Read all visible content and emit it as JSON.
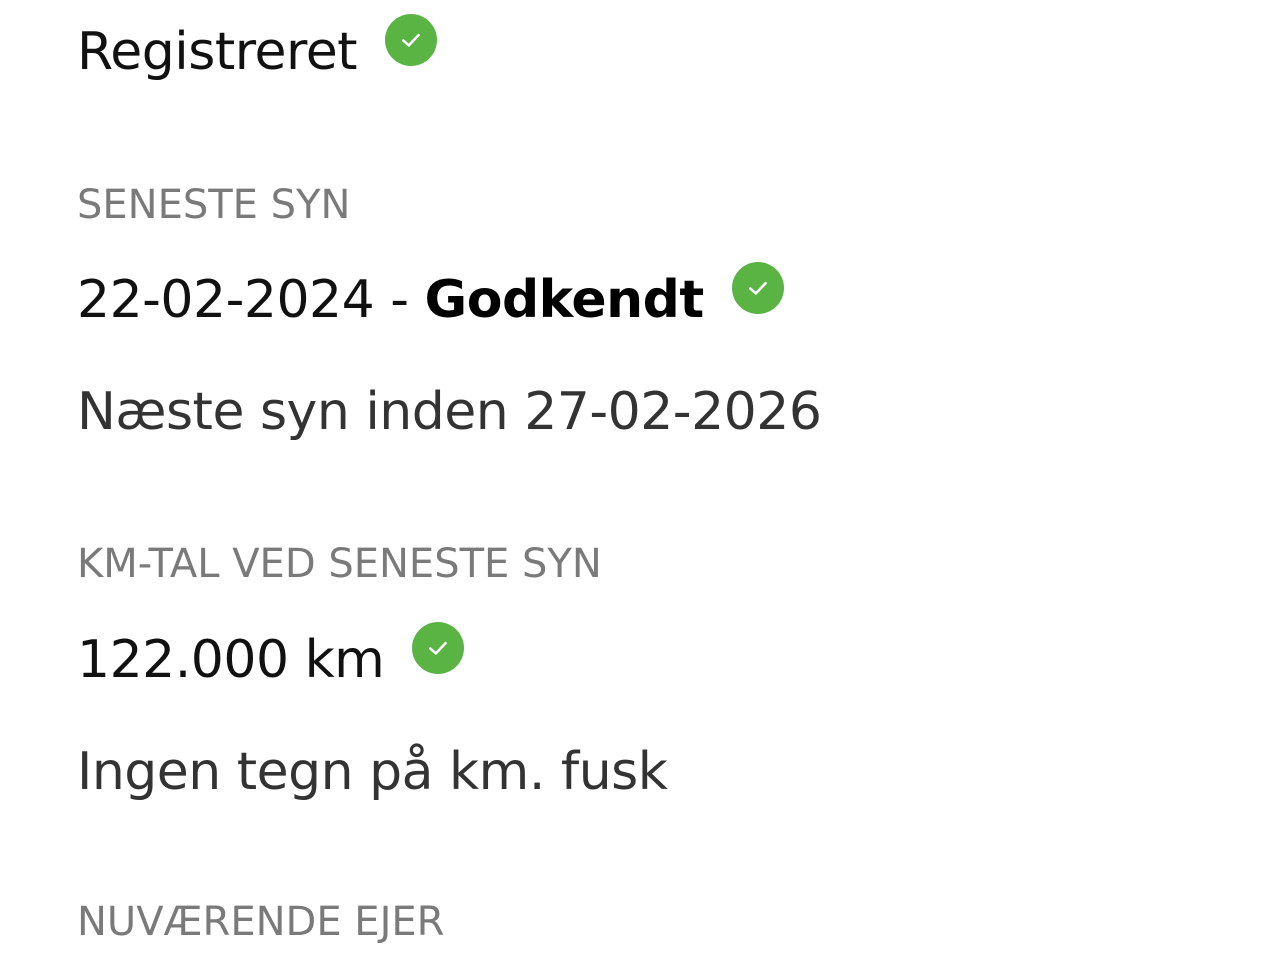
{
  "registration": {
    "status_text": "Registreret",
    "status_icon": "check-circle-icon"
  },
  "inspection": {
    "label": "SENESTE SYN",
    "date": "22-02-2024",
    "separator": " - ",
    "result": "Godkendt",
    "result_icon": "check-circle-icon",
    "next_inspection_text": "Næste syn inden 27-02-2026"
  },
  "mileage": {
    "label": "KM-TAL VED SENESTE SYN",
    "value": "122.000 km",
    "value_icon": "check-circle-icon",
    "fraud_text": "Ingen tegn på km. fusk"
  },
  "owner": {
    "label": "NUVÆRENDE EJER"
  },
  "colors": {
    "check_green": "#5ab443",
    "label_gray": "#7a7a7a",
    "text_dark": "#111111"
  }
}
